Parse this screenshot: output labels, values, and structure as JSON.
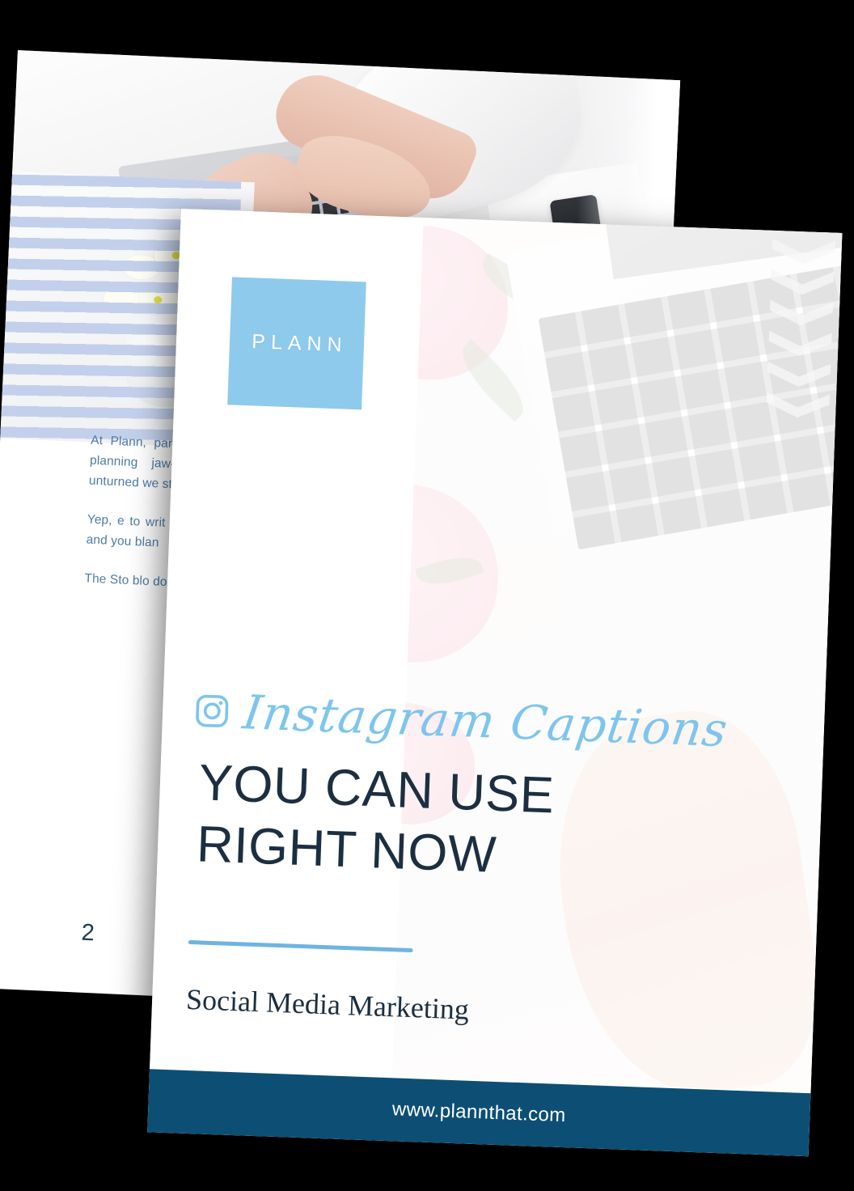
{
  "document": {
    "type": "ebook-cover-mockup",
    "colors": {
      "accent_light_blue": "#8ecaec",
      "script_blue": "#7ec5ee",
      "rule_blue": "#6fb4e0",
      "footer_navy": "#0d4f74",
      "heading_navy": "#1c2f41",
      "body_blue": "#4d7ca6",
      "stripe_lavender": "#c3d0ec",
      "page_white": "#ffffff",
      "background": "#000000"
    }
  },
  "front_cover": {
    "logo": {
      "text": "PLANN",
      "icon": "plann-logo-square"
    },
    "instagram_icon": "instagram-icon",
    "script_title": "Instagram Captions",
    "headline_line1": "YOU CAN USE",
    "headline_line2": "RIGHT NOW",
    "subtitle": "Social Media Marketing",
    "footer_url": "www.plannthat.com",
    "photo_description": "pink peonies beside a laptop keyboard with a hand typing, chevron pattern top-right"
  },
  "back_page": {
    "paragraphs": [
      "At Plann, part of yo more stre planning jaw-dropi at the o unturned we still heck s caption",
      "Yep, e to writ can fe say e medi and you blan",
      "The Sto blo do fro a c p"
    ],
    "page_number": "2",
    "photo_description": "overhead desk photo: hands typing on a laptop, phone and notepad on white desk",
    "flower_photo_description": "white daisies in a textured white vase behind lavender horizontal stripes"
  }
}
